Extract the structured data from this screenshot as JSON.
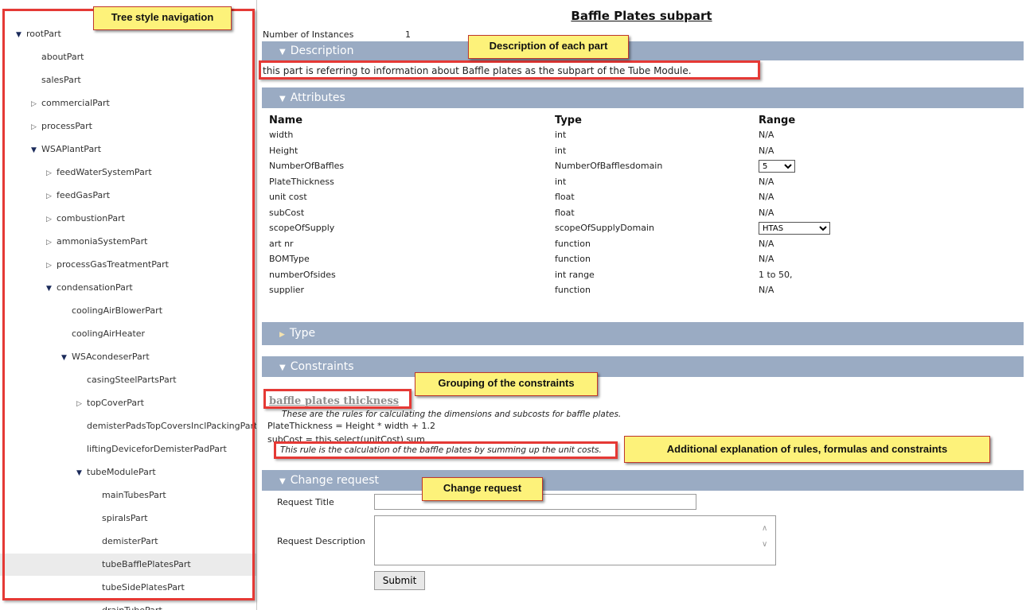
{
  "tree": [
    {
      "label": "rootPart",
      "depth": 0,
      "state": "open"
    },
    {
      "label": "aboutPart",
      "depth": 1,
      "state": "leaf"
    },
    {
      "label": "salesPart",
      "depth": 1,
      "state": "leaf"
    },
    {
      "label": "commercialPart",
      "depth": 1,
      "state": "closed"
    },
    {
      "label": "processPart",
      "depth": 1,
      "state": "closed"
    },
    {
      "label": "WSAPlantPart",
      "depth": 1,
      "state": "open"
    },
    {
      "label": "feedWaterSystemPart",
      "depth": 2,
      "state": "closed"
    },
    {
      "label": "feedGasPart",
      "depth": 2,
      "state": "closed"
    },
    {
      "label": "combustionPart",
      "depth": 2,
      "state": "closed"
    },
    {
      "label": "ammoniaSystemPart",
      "depth": 2,
      "state": "closed"
    },
    {
      "label": "processGasTreatmentPart",
      "depth": 2,
      "state": "closed"
    },
    {
      "label": "condensationPart",
      "depth": 2,
      "state": "open"
    },
    {
      "label": "coolingAirBlowerPart",
      "depth": 3,
      "state": "leaf"
    },
    {
      "label": "coolingAirHeater",
      "depth": 3,
      "state": "leaf"
    },
    {
      "label": "WSAcondeserPart",
      "depth": 3,
      "state": "open"
    },
    {
      "label": "casingSteelPartsPart",
      "depth": 4,
      "state": "leaf"
    },
    {
      "label": "topCoverPart",
      "depth": 4,
      "state": "closed"
    },
    {
      "label": "demisterPadsTopCoversInclPackingPart",
      "depth": 4,
      "state": "leaf"
    },
    {
      "label": "liftingDeviceforDemisterPadPart",
      "depth": 4,
      "state": "leaf"
    },
    {
      "label": "tubeModulePart",
      "depth": 4,
      "state": "open"
    },
    {
      "label": "mainTubesPart",
      "depth": 5,
      "state": "leaf"
    },
    {
      "label": "spiralsPart",
      "depth": 5,
      "state": "leaf"
    },
    {
      "label": "demisterPart",
      "depth": 5,
      "state": "leaf"
    },
    {
      "label": "tubeBafflePlatesPart",
      "depth": 5,
      "state": "leaf",
      "selected": true
    },
    {
      "label": "tubeSidePlatesPart",
      "depth": 5,
      "state": "leaf"
    },
    {
      "label": "drainTubePart",
      "depth": 5,
      "state": "leaf"
    }
  ],
  "page": {
    "title": "Baffle Plates subpart",
    "instances_label": "Number of Instances",
    "instances_value": "1"
  },
  "sections": {
    "description": "Description",
    "attributes": "Attributes",
    "type": "Type",
    "constraints": "Constraints",
    "change_request": "Change request"
  },
  "description_text": "this part is referring to information about Baffle plates as the subpart of the Tube Module.",
  "attributes": {
    "headers": [
      "Name",
      "Type",
      "Range"
    ],
    "rows": [
      {
        "name": "width",
        "type": "int",
        "range": "N/A"
      },
      {
        "name": "Height",
        "type": "int",
        "range": "N/A"
      },
      {
        "name": "NumberOfBaffles",
        "type": "NumberOfBafflesdomain",
        "range": "5",
        "dropdown": true
      },
      {
        "name": "PlateThickness",
        "type": "int",
        "range": "N/A"
      },
      {
        "name": "unit cost",
        "type": "float",
        "range": "N/A"
      },
      {
        "name": "subCost",
        "type": "float",
        "range": "N/A"
      },
      {
        "name": "scopeOfSupply",
        "type": "scopeOfSupplyDomain",
        "range": "HTAS",
        "dropdown": true
      },
      {
        "name": "art nr",
        "type": "function",
        "range": "N/A"
      },
      {
        "name": "BOMType",
        "type": "function",
        "range": "N/A"
      },
      {
        "name": "numberOfsides",
        "type": "int range",
        "range": "1 to 50,"
      },
      {
        "name": "supplier",
        "type": "function",
        "range": "N/A"
      }
    ]
  },
  "constraints": {
    "group_title": "baffle plates thickness",
    "group_desc": "These are the rules for calculating the dimensions and subcosts for baffle plates.",
    "rule1": "PlateThickness = Height * width + 1.2",
    "rule2": "subCost = this.select(unitCost).sum",
    "rule2_explain": "This rule is the calculation of the baffle plates by summing up the unit costs."
  },
  "change_request": {
    "title_label": "Request Title",
    "title_value": "",
    "desc_label": "Request Description",
    "desc_value": "",
    "submit_label": "Submit"
  },
  "callouts": {
    "tree": "Tree style navigation",
    "description": "Description of each part",
    "grouping": "Grouping of the constraints",
    "explanation": "Additional explanation of rules, formulas and constraints",
    "change_request": "Change request"
  },
  "colors": {
    "section_band": "#9aabc3",
    "callout_bg": "#fdf27a",
    "annotation_red": "#e53935"
  }
}
